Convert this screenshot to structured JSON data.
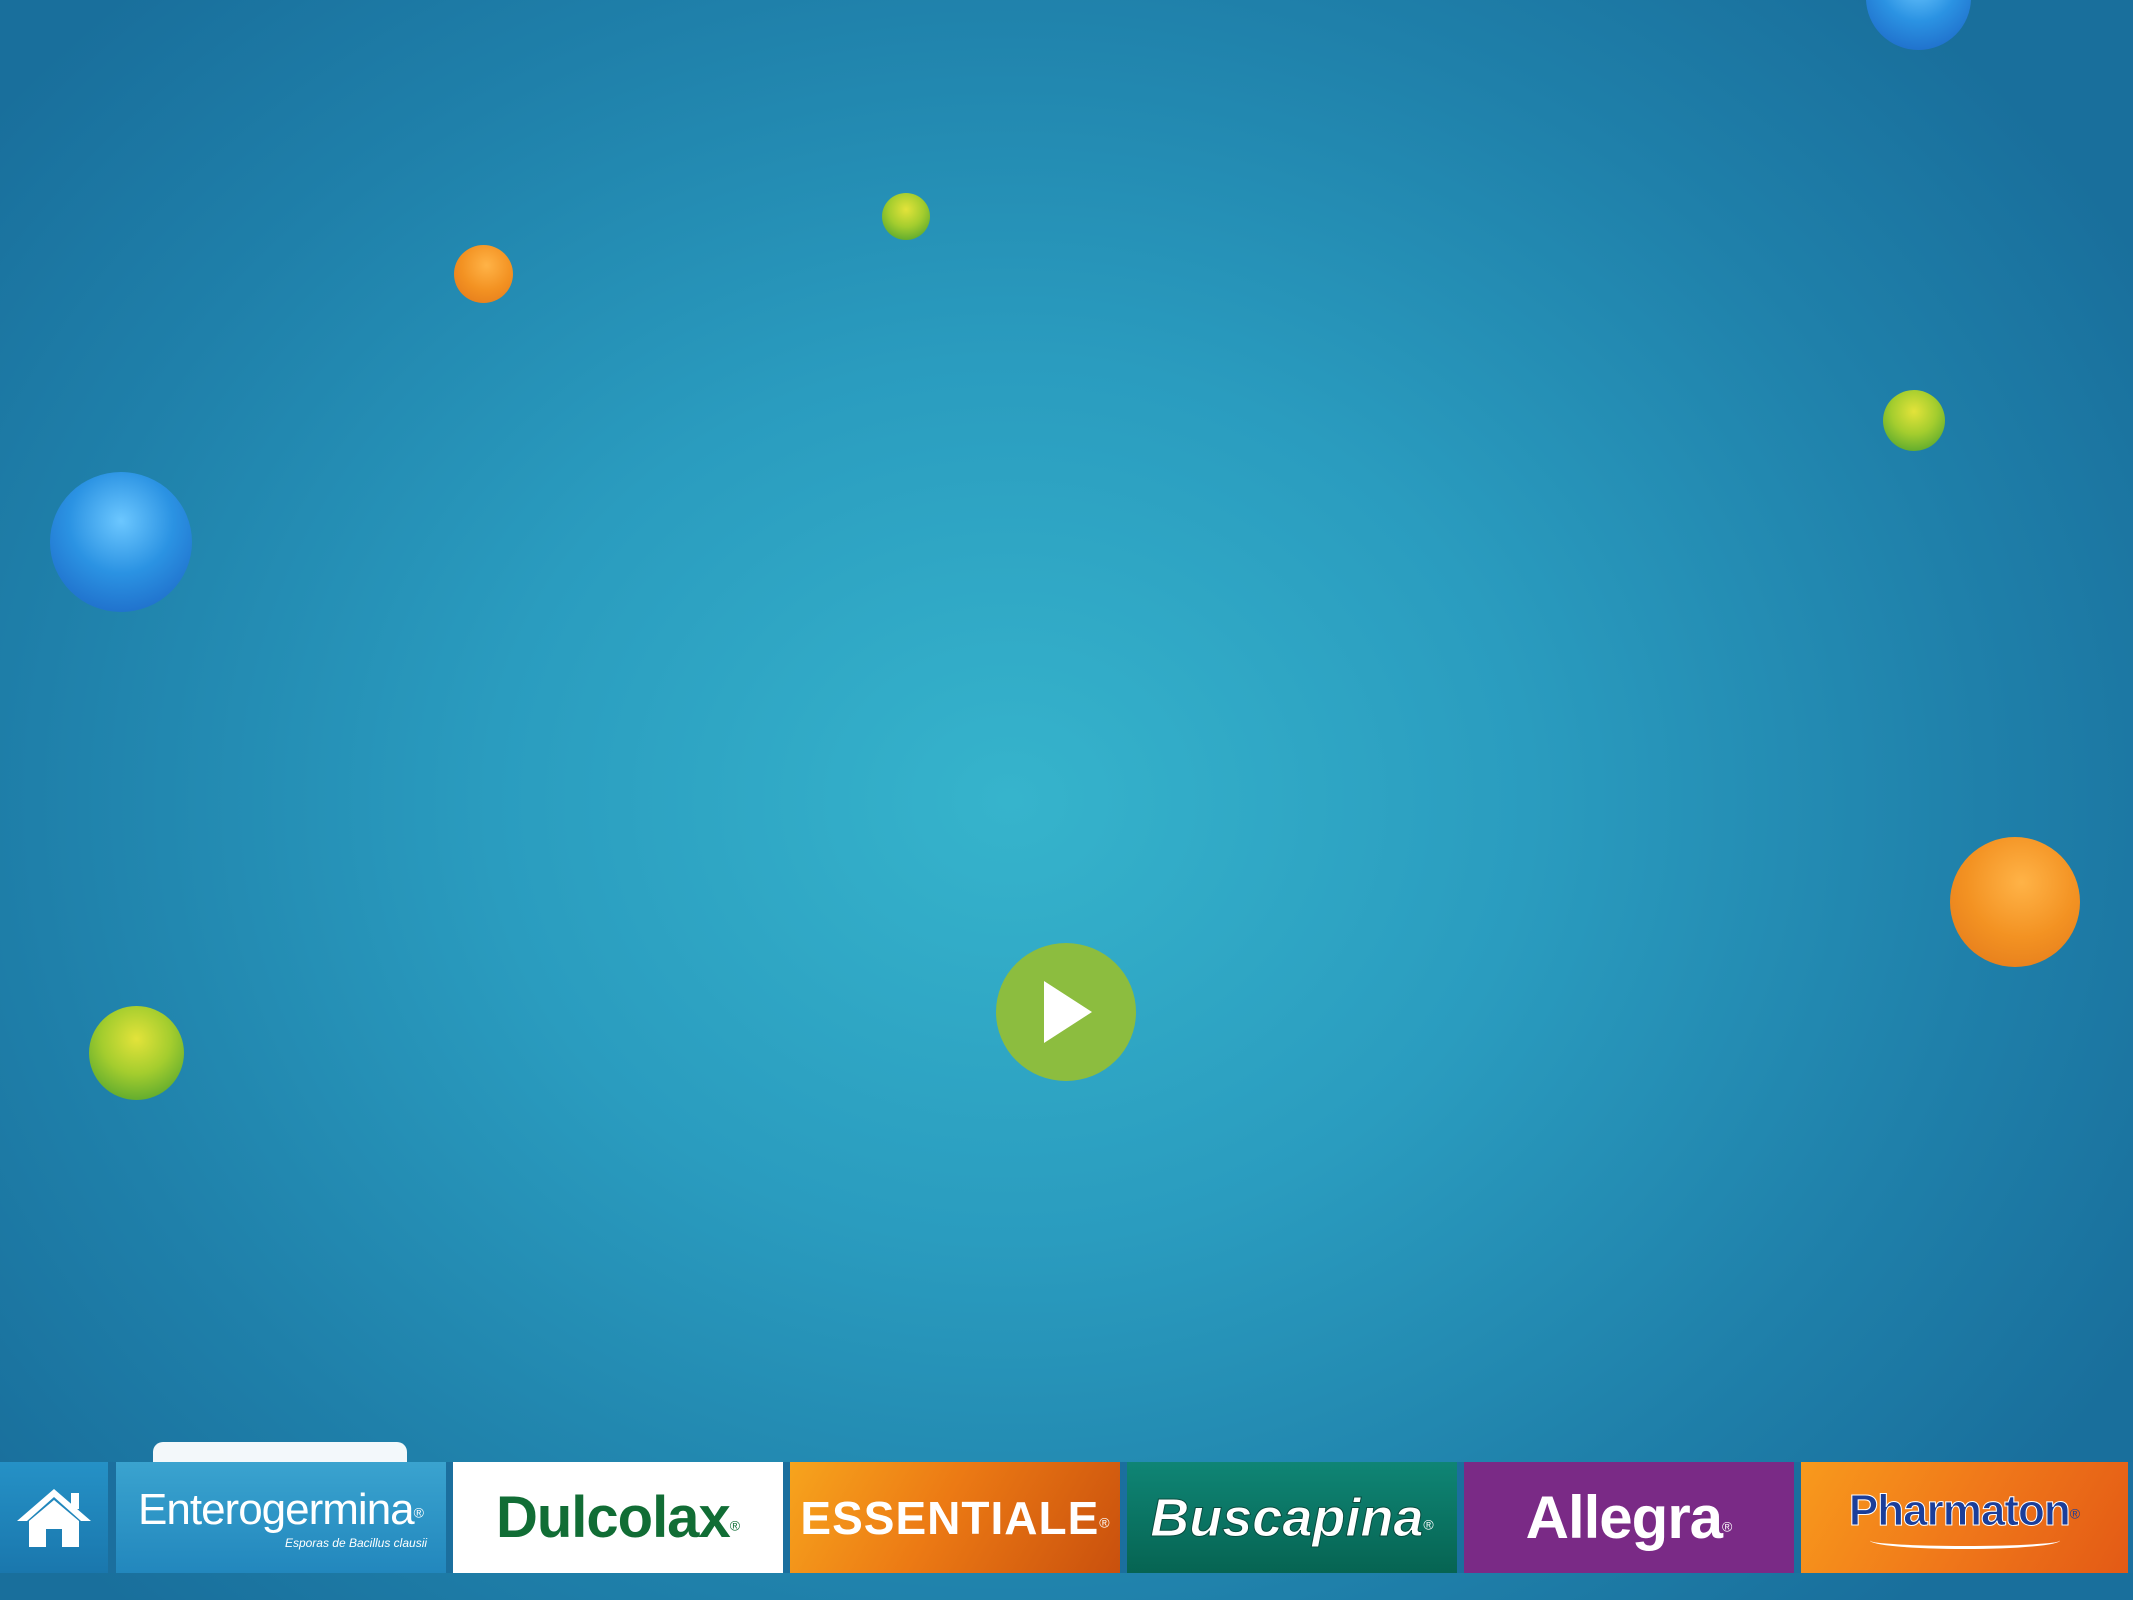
{
  "screen": {
    "colors": {
      "background_center": "#36b4cc",
      "background_edge": "#196f9c",
      "play_button": "#8cbd3f"
    }
  },
  "decorations": {
    "balls": [
      {
        "color": "blue"
      },
      {
        "color": "green"
      },
      {
        "color": "orange"
      },
      {
        "color": "green"
      },
      {
        "color": "blue"
      },
      {
        "color": "orange"
      },
      {
        "color": "green"
      }
    ]
  },
  "player": {
    "icon": "play-icon"
  },
  "navbar": {
    "home_icon": "home-icon",
    "items": [
      {
        "label": "Enterogermina",
        "sublabel": "Esporas de Bacillus clausii",
        "color": "#2287bd"
      },
      {
        "label": "Dulcolax",
        "color": "#ffffff"
      },
      {
        "label": "ESSENTIALE",
        "color": "#ec7a14"
      },
      {
        "label": "Buscapina",
        "color": "#0f8575"
      },
      {
        "label": "Allegra",
        "color": "#7a2a86"
      },
      {
        "label": "Pharmaton",
        "color": "#f0781a"
      }
    ]
  }
}
